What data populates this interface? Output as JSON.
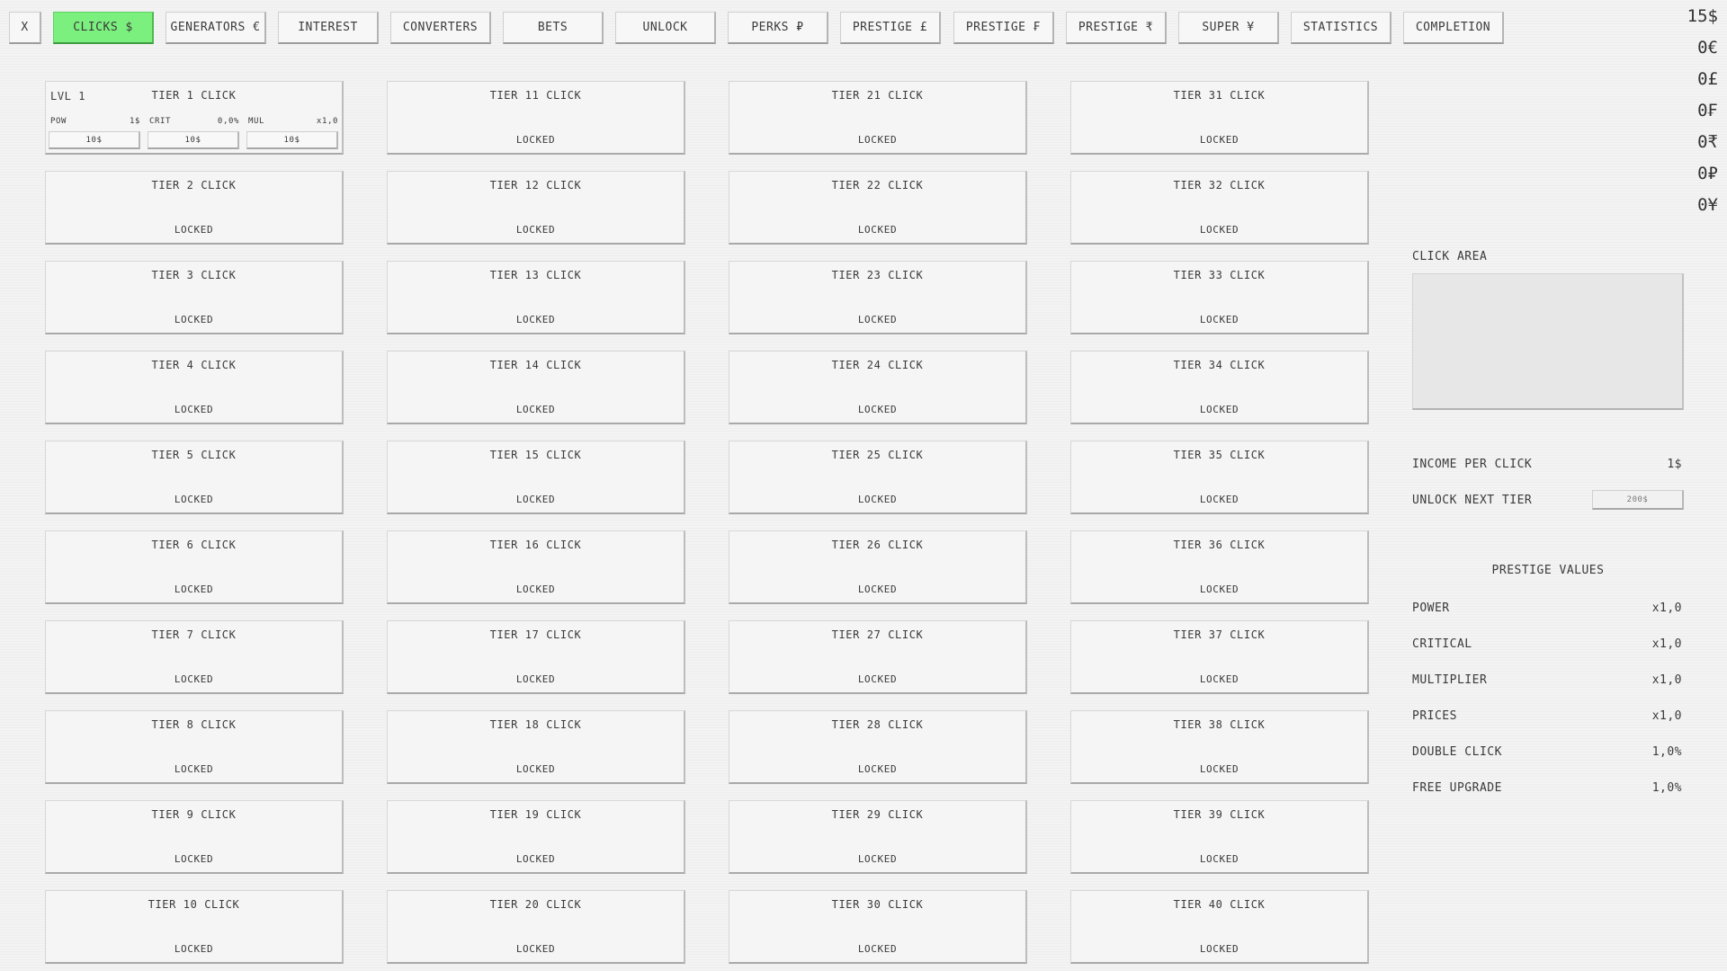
{
  "nav": [
    {
      "label": "X",
      "active": false,
      "name": "close-button"
    },
    {
      "label": "CLICKS $",
      "active": true,
      "name": "tab-clicks"
    },
    {
      "label": "GENERATORS €",
      "active": false,
      "name": "tab-generators"
    },
    {
      "label": "INTEREST",
      "active": false,
      "name": "tab-interest"
    },
    {
      "label": "CONVERTERS",
      "active": false,
      "name": "tab-converters"
    },
    {
      "label": "BETS",
      "active": false,
      "name": "tab-bets"
    },
    {
      "label": "UNLOCK",
      "active": false,
      "name": "tab-unlock"
    },
    {
      "label": "PERKS ₽",
      "active": false,
      "name": "tab-perks"
    },
    {
      "label": "PRESTIGE £",
      "active": false,
      "name": "tab-prestige-pound"
    },
    {
      "label": "PRESTIGE ₣",
      "active": false,
      "name": "tab-prestige-franc"
    },
    {
      "label": "PRESTIGE ₹",
      "active": false,
      "name": "tab-prestige-rupee"
    },
    {
      "label": "SUPER ¥",
      "active": false,
      "name": "tab-super"
    },
    {
      "label": "STATISTICS",
      "active": false,
      "name": "tab-statistics"
    },
    {
      "label": "COMPLETION",
      "active": false,
      "name": "tab-completion"
    }
  ],
  "currencies": [
    "15$",
    "0€",
    "0£",
    "0₣",
    "0₹",
    "0₽",
    "0¥"
  ],
  "tier1": {
    "title": "TIER 1 CLICK",
    "level": "LVL 1",
    "stats": [
      {
        "label": "POW",
        "value": "1$",
        "cost": "10$"
      },
      {
        "label": "CRIT",
        "value": "0,0%",
        "cost": "10$"
      },
      {
        "label": "MUL",
        "value": "x1,0",
        "cost": "10$"
      }
    ]
  },
  "tier_title_suffix": " CLICK",
  "tier_title_prefix": "TIER ",
  "locked_label": "LOCKED",
  "side": {
    "click_area_label": "CLICK AREA",
    "income_label": "INCOME PER CLICK",
    "income_value": "1$",
    "unlock_label": "UNLOCK NEXT TIER",
    "unlock_cost": "200$",
    "prestige_title": "PRESTIGE VALUES",
    "prestige": [
      {
        "label": "POWER",
        "value": "x1,0"
      },
      {
        "label": "CRITICAL",
        "value": "x1,0"
      },
      {
        "label": "MULTIPLIER",
        "value": "x1,0"
      },
      {
        "label": "PRICES",
        "value": "x1,0"
      },
      {
        "label": "DOUBLE CLICK",
        "value": "1,0%"
      },
      {
        "label": "FREE UPGRADE",
        "value": "1,0%"
      }
    ]
  }
}
